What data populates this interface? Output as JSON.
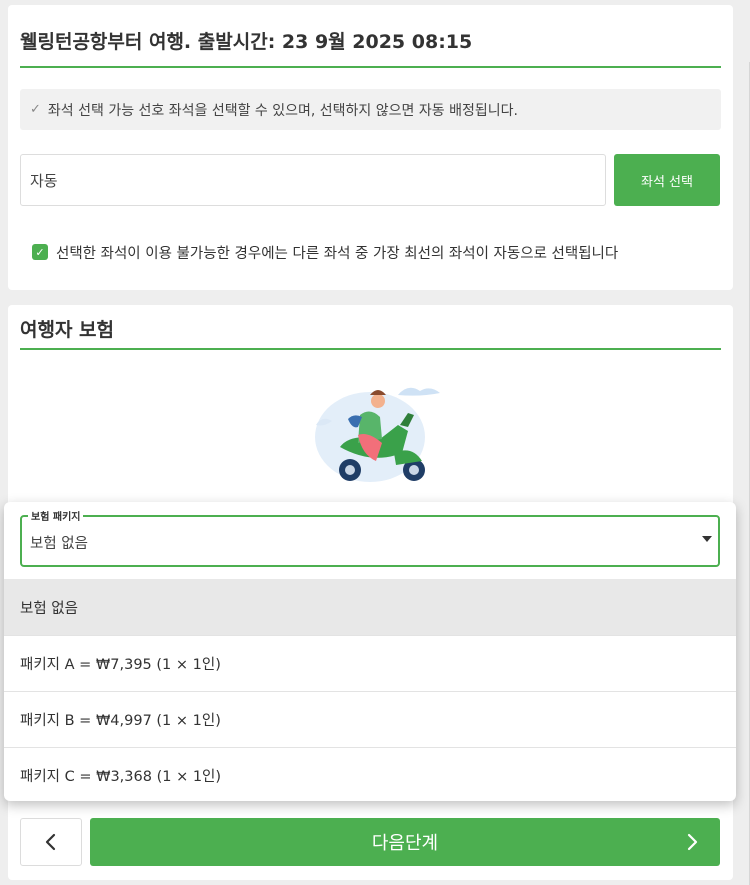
{
  "seat_section": {
    "title": "웰링턴공항부터 여행. 출발시간: 23 9월 2025 08:15",
    "info": "좌석 선택 가능 선호 좌석을 선택할 수 있으며, 선택하지 않으면 자동 배정됩니다.",
    "seat_value": "자동",
    "select_button": "좌석 선택",
    "auto_fallback_text": "선택한 좌석이 이용 불가능한 경우에는 다른 좌석 중 가장 최선의 좌석이 자동으로 선택됩니다",
    "auto_fallback_checked": true
  },
  "insurance_section": {
    "title": "여행자 보험",
    "illustration": "scooter-traveler-illustration",
    "select": {
      "label": "보험 패키지",
      "value": "보험 없음"
    },
    "options": [
      {
        "label": "보험 없음",
        "selected": true
      },
      {
        "label": "패키지 A = ₩7,395 (1 × 1인)",
        "selected": false
      },
      {
        "label": "패키지 B = ₩4,997 (1 × 1인)",
        "selected": false
      },
      {
        "label": "패키지 C = ₩3,368 (1 × 1인)",
        "selected": false
      }
    ]
  },
  "footer": {
    "back_icon": "chevron-left-icon",
    "next_label": "다음단계",
    "next_icon": "chevron-right-icon"
  },
  "colors": {
    "accent": "#4caf50",
    "background": "#eeeeee",
    "info_box": "#f1f1f1",
    "selected_option": "#e8e8e8"
  }
}
